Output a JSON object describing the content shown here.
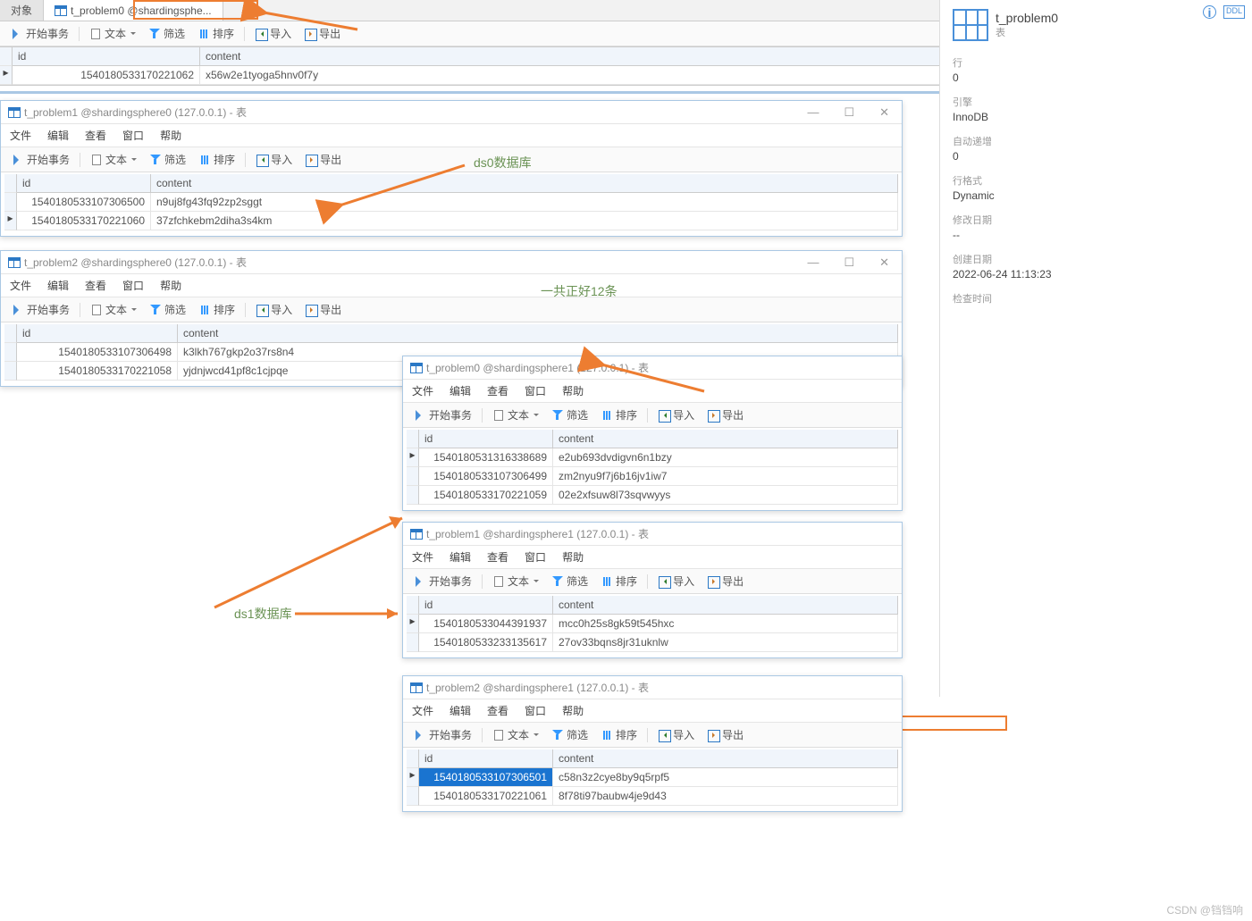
{
  "topTabs": {
    "objects": "对象",
    "active": "t_problem0 @shardingsphe..."
  },
  "menu": {
    "file": "文件",
    "edit": "编辑",
    "view": "查看",
    "window": "窗口",
    "help": "帮助"
  },
  "toolbar": {
    "begin": "开始事务",
    "text": "文本",
    "filter": "筛选",
    "sort": "排序",
    "import": "导入",
    "export": "导出"
  },
  "cols": {
    "id": "id",
    "content": "content"
  },
  "annotations": {
    "ds0": "ds0数据库",
    "total": "一共正好12条",
    "ds1": "ds1数据库"
  },
  "topGrid": {
    "rows": [
      {
        "id": "1540180533170221062",
        "content": "x56w2e1tyoga5hnv0f7y"
      }
    ]
  },
  "wins": {
    "w1": {
      "title": "t_problem1 @shardingsphere0 (127.0.0.1) - 表",
      "rows": [
        {
          "id": "1540180533107306500",
          "content": "n9uj8fg43fq92zp2sggt"
        },
        {
          "id": "1540180533170221060",
          "content": "37zfchkebm2diha3s4km"
        }
      ]
    },
    "w2": {
      "title": "t_problem2 @shardingsphere0 (127.0.0.1) - 表",
      "rows": [
        {
          "id": "1540180533107306498",
          "content": "k3lkh767gkp2o37rs8n4"
        },
        {
          "id": "1540180533170221058",
          "content": "yjdnjwcd41pf8c1cjpqe"
        }
      ]
    },
    "w3": {
      "title": "t_problem0 @shardingsphere1 (127.0.0.1) - 表",
      "titleHL": "shardingsphere1 (1",
      "rows": [
        {
          "id": "1540180531316338689",
          "content": "e2ub693dvdigvn6n1bzy"
        },
        {
          "id": "1540180533107306499",
          "content": "zm2nyu9f7j6b16jv1iw7"
        },
        {
          "id": "1540180533170221059",
          "content": "02e2xfsuw8l73sqvwyys"
        }
      ]
    },
    "w4": {
      "title": "t_problem1 @shardingsphere1 (127.0.0.1) - 表",
      "rows": [
        {
          "id": "1540180533044391937",
          "content": "mcc0h25s8gk59t545hxc"
        },
        {
          "id": "1540180533233135617",
          "content": "27ov33bqns8jr31uknlw"
        }
      ]
    },
    "w5": {
      "title": "t_problem2 @shardingsphere1 (127.0.0.1) - 表",
      "rows": [
        {
          "id": "1540180533107306501",
          "content": "c58n3z2cye8by9q5rpf5",
          "sel": true
        },
        {
          "id": "1540180533170221061",
          "content": "8f78ti97baubw4je9d43"
        }
      ]
    }
  },
  "info": {
    "title": "t_problem0",
    "subtitle": "表",
    "rowsLabel": "行",
    "rowsValue": "0",
    "engineLabel": "引擎",
    "engineValue": "InnoDB",
    "aiLabel": "自动递增",
    "aiValue": "0",
    "fmtLabel": "行格式",
    "fmtValue": "Dynamic",
    "modLabel": "修改日期",
    "modValue": "--",
    "crtLabel": "创建日期",
    "crtValue": "2022-06-24 11:13:23",
    "chkLabel": "检查时间"
  },
  "watermark": "CSDN @铛铛响"
}
